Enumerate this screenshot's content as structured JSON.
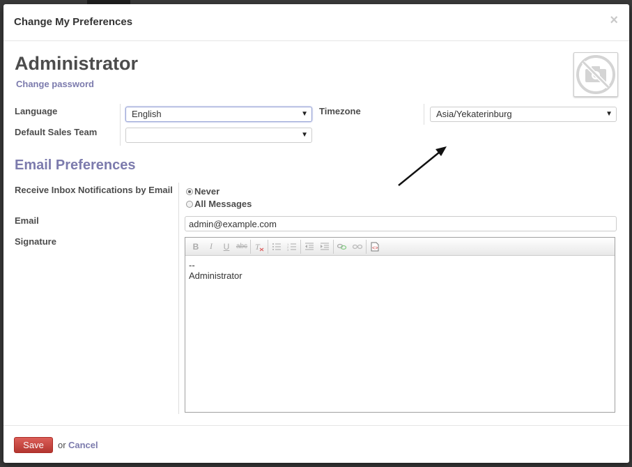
{
  "dialog": {
    "title": "Change My Preferences",
    "close_symbol": "×"
  },
  "user": {
    "name": "Administrator",
    "change_password_label": "Change password"
  },
  "fields": {
    "language_label": "Language",
    "language_value": "English",
    "timezone_label": "Timezone",
    "timezone_value": "Asia/Yekaterinburg",
    "sales_team_label": "Default Sales Team",
    "sales_team_value": ""
  },
  "email_prefs": {
    "section_title": "Email Preferences",
    "notifications_label": "Receive Inbox Notifications by Email",
    "options": [
      {
        "label": "Never",
        "selected": true
      },
      {
        "label": "All Messages",
        "selected": false
      }
    ],
    "email_label": "Email",
    "email_value": "admin@example.com",
    "signature_label": "Signature",
    "signature_lines": [
      "--",
      "Administrator"
    ]
  },
  "footer": {
    "save_label": "Save",
    "or_text": "or",
    "cancel_label": "Cancel"
  },
  "colors": {
    "accent": "#7c7bad",
    "save_button": "#c0392b"
  }
}
